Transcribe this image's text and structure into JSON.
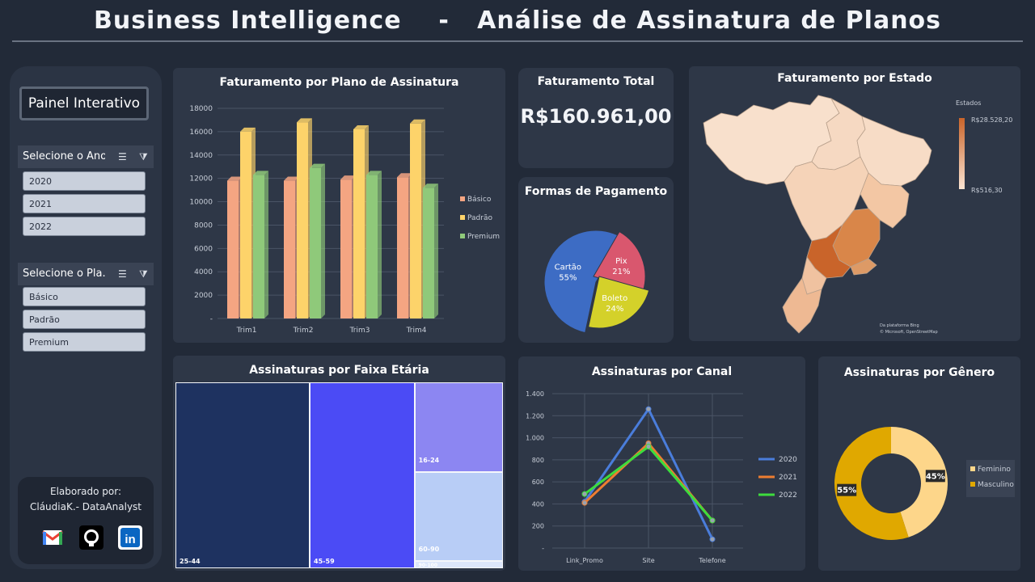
{
  "header": {
    "title": "Business Intelligence    -   Análise de Assinatura de Planos"
  },
  "sidebar": {
    "title": "Painel Interativo",
    "year_slicer": {
      "label": "Selecione o Ano:",
      "items": [
        "2020",
        "2021",
        "2022"
      ]
    },
    "plan_slicer": {
      "label": "Selecione o Pla...",
      "items": [
        "Básico",
        "Padrão",
        "Premium"
      ]
    },
    "credit": {
      "line1": "Elaborado por:",
      "line2": "CláudiaK.- DataAnalyst"
    },
    "icons": [
      "gmail-icon",
      "github-icon",
      "linkedin-icon"
    ]
  },
  "kpi": {
    "title": "Faturamento Total",
    "value": "R$160.961,00"
  },
  "map": {
    "title": "Faturamento por Estado",
    "legend_title": "Estados",
    "legend_max": "R$28.528,20",
    "legend_min": "R$516,30",
    "credit1": "Da plataforma Bing",
    "credit2": "© Microsoft, OpenStreetMap"
  },
  "colors": {
    "basico": "#f4a582",
    "padrao": "#fdd36a",
    "premium": "#8fc97a",
    "cartao": "#3d6cc4",
    "pix": "#d9576e",
    "boleto": "#d4d12a",
    "feminino": "#fdd68a",
    "masculino": "#e0a800",
    "line2020": "#4a7ddb",
    "line2021": "#ed7d31",
    "line2022": "#3ddc3d"
  },
  "chart_data": [
    {
      "type": "bar",
      "title": "Faturamento por Plano de Assinatura",
      "categories": [
        "Trim1",
        "Trim2",
        "Trim3",
        "Trim4"
      ],
      "series": [
        {
          "name": "Básico",
          "values": [
            11800,
            11800,
            11900,
            12100
          ]
        },
        {
          "name": "Padrão",
          "values": [
            16000,
            16800,
            16200,
            16700
          ]
        },
        {
          "name": "Premium",
          "values": [
            12300,
            12900,
            12300,
            11200
          ]
        }
      ],
      "ylim": [
        0,
        18000
      ],
      "yticks": [
        "-",
        "2000",
        "4000",
        "6000",
        "8000",
        "10000",
        "12000",
        "14000",
        "16000",
        "18000"
      ],
      "legend": "right"
    },
    {
      "type": "pie",
      "title": "Formas de Pagamento",
      "slices": [
        {
          "name": "Cartão",
          "value": 55,
          "label": "55%"
        },
        {
          "name": "Pix",
          "value": 21,
          "label": "21%"
        },
        {
          "name": "Boleto",
          "value": 24,
          "label": "24%"
        }
      ]
    },
    {
      "type": "treemap",
      "title": "Assinaturas por Faixa Etária",
      "items": [
        {
          "name": "25-44",
          "value": 41
        },
        {
          "name": "45-59",
          "value": 32
        },
        {
          "name": "16-24",
          "value": 13
        },
        {
          "name": "60-90",
          "value": 13
        },
        {
          "name": "90-100",
          "value": 1
        }
      ]
    },
    {
      "type": "line",
      "title": "Assinaturas por Canal",
      "categories": [
        "Link_Promo",
        "Site",
        "Telefone"
      ],
      "series": [
        {
          "name": "2020",
          "values": [
            420,
            1260,
            80
          ]
        },
        {
          "name": "2021",
          "values": [
            410,
            950,
            250
          ]
        },
        {
          "name": "2022",
          "values": [
            490,
            920,
            250
          ]
        }
      ],
      "ylim": [
        0,
        1400
      ],
      "yticks": [
        "-",
        "200",
        "400",
        "600",
        "800",
        "1.000",
        "1.200",
        "1.400"
      ],
      "legend": "right"
    },
    {
      "type": "pie",
      "title": "Assinaturas por Gênero",
      "donut": true,
      "slices": [
        {
          "name": "Feminino",
          "value": 45,
          "label": "45%"
        },
        {
          "name": "Masculino",
          "value": 55,
          "label": "55%"
        }
      ],
      "legend": "right"
    }
  ]
}
